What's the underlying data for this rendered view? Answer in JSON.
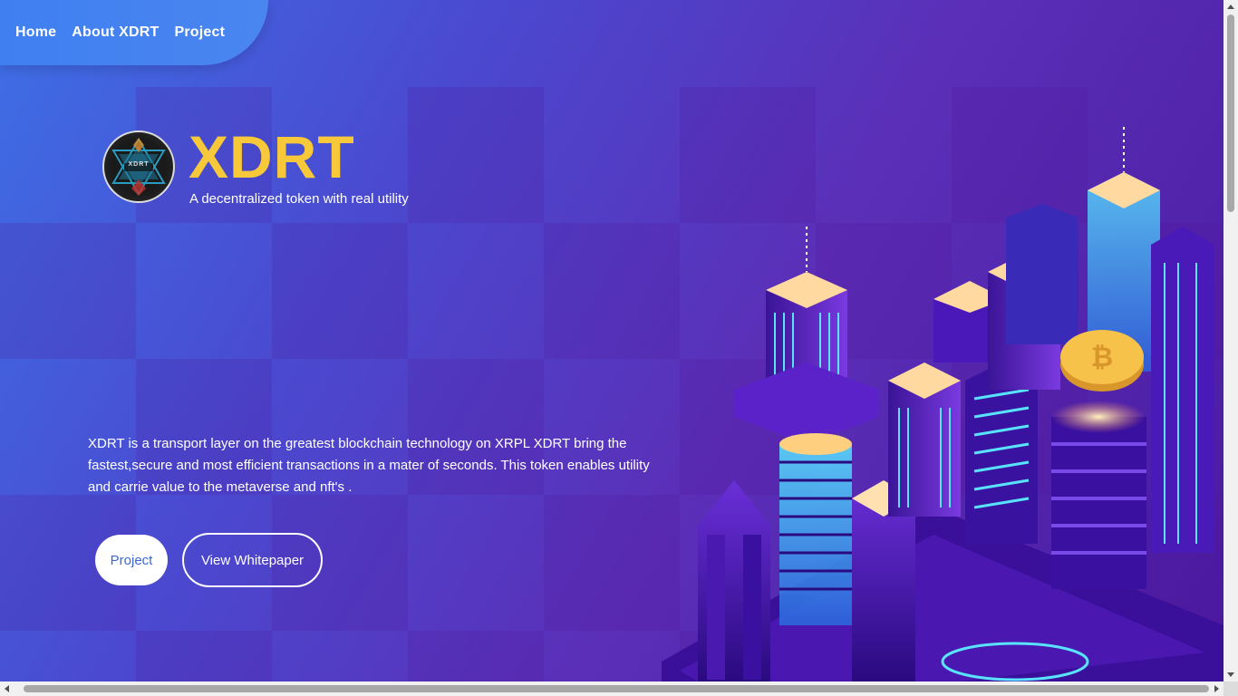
{
  "nav": {
    "items": [
      {
        "label": "Home"
      },
      {
        "label": "About XDRT"
      },
      {
        "label": "Project"
      }
    ]
  },
  "hero": {
    "logo_text": "XDRT",
    "title": "XDRT",
    "tagline": "A decentralized token with real utility",
    "description": "XDRT is a transport layer on the greatest blockchain technology on XRPL XDRT bring the fastest,secure and most efficient transactions in a mater of seconds. This token enables utility and carrie value to the metaverse and nft's .",
    "buttons": {
      "project": "Project",
      "whitepaper": "View Whitepaper"
    }
  },
  "colors": {
    "title": "#f7c83a",
    "nav_bg": "#4a86f0",
    "background": "#5b2fb8"
  },
  "icons": [
    "xdrt-logo-icon",
    "city-illustration",
    "bitcoin-coin-icon"
  ]
}
